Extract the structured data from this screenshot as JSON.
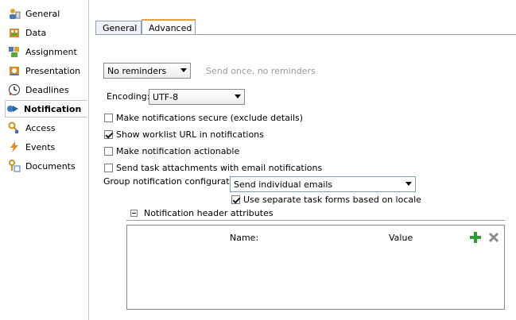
{
  "sidebar": {
    "items": [
      {
        "label": "General",
        "icon": "general-icon"
      },
      {
        "label": "Data",
        "icon": "data-icon"
      },
      {
        "label": "Assignment",
        "icon": "assignment-icon"
      },
      {
        "label": "Presentation",
        "icon": "presentation-icon"
      },
      {
        "label": "Deadlines",
        "icon": "clock-icon"
      },
      {
        "label": "Notification",
        "icon": "notification-icon"
      },
      {
        "label": "Access",
        "icon": "key-icon"
      },
      {
        "label": "Events",
        "icon": "lightning-icon"
      },
      {
        "label": "Documents",
        "icon": "documents-icon"
      }
    ],
    "active": "Notification"
  },
  "tabs": {
    "general": "General",
    "advanced": "Advanced",
    "selected": "Advanced"
  },
  "reminders": {
    "value": "No reminders",
    "hint": "Send once, no reminders"
  },
  "encoding": {
    "label": "Encoding:",
    "value": "UTF-8"
  },
  "checkboxes": {
    "secure": {
      "label": "Make notifications secure (exclude details)",
      "checked": false
    },
    "worklist": {
      "label": "Show worklist URL in notifications",
      "checked": true
    },
    "actionable": {
      "label": "Make notification actionable",
      "checked": false
    },
    "attachments": {
      "label": "Send task attachments with email notifications",
      "checked": false
    },
    "separate_forms": {
      "label": "Use separate task forms based on locale",
      "checked": true
    }
  },
  "group_config": {
    "label": "Group notification configuration:",
    "value": "Send individual emails"
  },
  "header_section": {
    "title": "Notification header attributes",
    "columns": {
      "name": "Name:",
      "value": "Value"
    }
  },
  "colors": {
    "accent_tab": "#e6a23c",
    "add": "#2e9e2e",
    "remove": "#8a8a8a"
  }
}
